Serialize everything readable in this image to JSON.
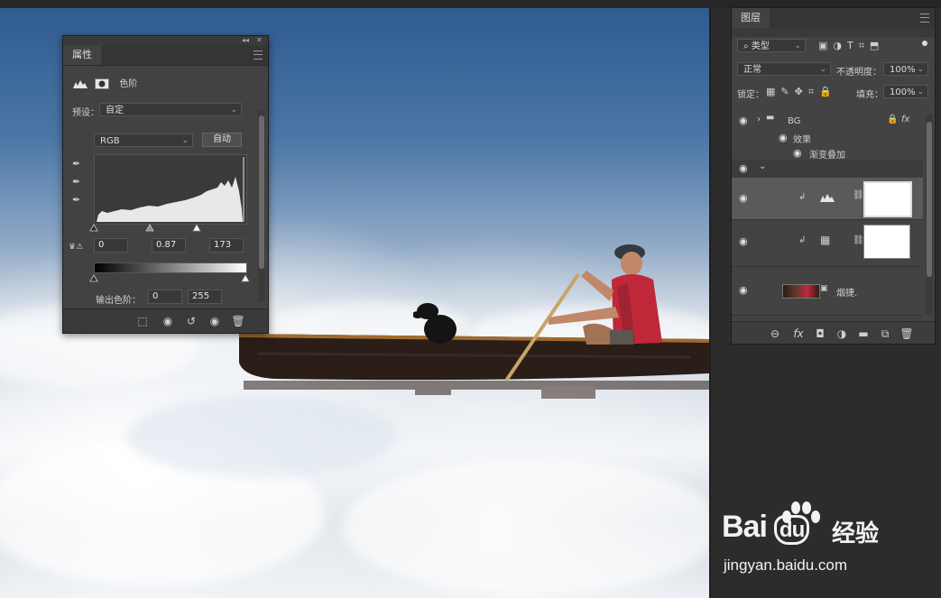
{
  "properties": {
    "tab": "属性",
    "adjustment_name": "色阶",
    "preset_label": "预设：",
    "preset_value": "自定",
    "channel": "RGB",
    "auto_button": "自动",
    "input_black": "0",
    "input_gamma": "0.87",
    "input_white": "173",
    "output_label": "输出色阶：",
    "output_black": "0",
    "output_white": "255"
  },
  "layers": {
    "tab": "图层",
    "filter_kind": "类型",
    "blend_mode": "正常",
    "opacity_label": "不透明度：",
    "opacity_value": "100%",
    "lock_label": "锁定：",
    "fill_label": "填充：",
    "fill_value": "100%",
    "group_name": "BG",
    "effects_label": "效果",
    "gradient_overlay_label": "渐变叠加",
    "boat_layer_name": "烟捷."
  },
  "watermark": {
    "brand_latin_a": "Bai",
    "brand_latin_b": "du",
    "brand_cn": "经验",
    "url": "jingyan.baidu.com"
  },
  "colors": {
    "panel_bg": "#424242",
    "accent_shirt": "#c0283a",
    "sky_top": "#2f5b90"
  },
  "icons": [
    "eyedropper-black-icon",
    "eyedropper-gray-icon",
    "eyedropper-white-icon",
    "eye-icon",
    "folder-icon",
    "chain-link-icon",
    "trash-icon",
    "fx-icon",
    "new-layer-icon",
    "mask-icon",
    "levels-icon",
    "search-icon",
    "lock-icon"
  ]
}
